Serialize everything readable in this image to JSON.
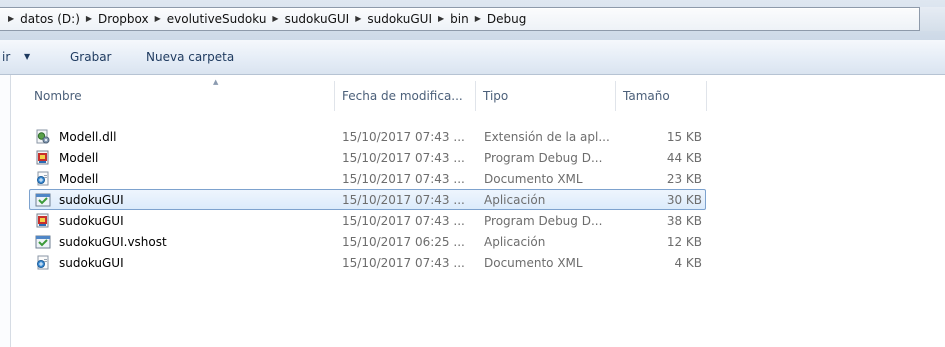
{
  "breadcrumb": [
    "datos (D:)",
    "Dropbox",
    "evolutiveSudoku",
    "sudokuGUI",
    "sudokuGUI",
    "bin",
    "Debug"
  ],
  "toolbar": {
    "organize_label": "ir",
    "burn_label": "Grabar",
    "new_folder_label": "Nueva carpeta"
  },
  "columns": {
    "name": "Nombre",
    "date": "Fecha de modifica...",
    "type": "Tipo",
    "size": "Tamaño"
  },
  "files": [
    {
      "name": "Modell.dll",
      "date": "15/10/2017 07:43 ...",
      "type": "Extensión de la apl...",
      "size": "15 KB",
      "icon": "dll-icon"
    },
    {
      "name": "Modell",
      "date": "15/10/2017 07:43 ...",
      "type": "Program Debug D...",
      "size": "44 KB",
      "icon": "pdb-icon"
    },
    {
      "name": "Modell",
      "date": "15/10/2017 07:43 ...",
      "type": "Documento XML",
      "size": "23 KB",
      "icon": "xml-icon"
    },
    {
      "name": "sudokuGUI",
      "date": "15/10/2017 07:43 ...",
      "type": "Aplicación",
      "size": "30 KB",
      "icon": "exe-icon",
      "selected": true
    },
    {
      "name": "sudokuGUI",
      "date": "15/10/2017 07:43 ...",
      "type": "Program Debug D...",
      "size": "38 KB",
      "icon": "pdb-icon"
    },
    {
      "name": "sudokuGUI.vshost",
      "date": "15/10/2017 06:25 ...",
      "type": "Aplicación",
      "size": "12 KB",
      "icon": "exe-icon"
    },
    {
      "name": "sudokuGUI",
      "date": "15/10/2017 07:43 ...",
      "type": "Documento XML",
      "size": "4 KB",
      "icon": "xml-icon"
    }
  ],
  "colors": {
    "selection_border": "#7da2ce",
    "selection_fill": "#dcebfb",
    "header_text": "#4c607a",
    "secondary_text": "#6d6d6d"
  }
}
